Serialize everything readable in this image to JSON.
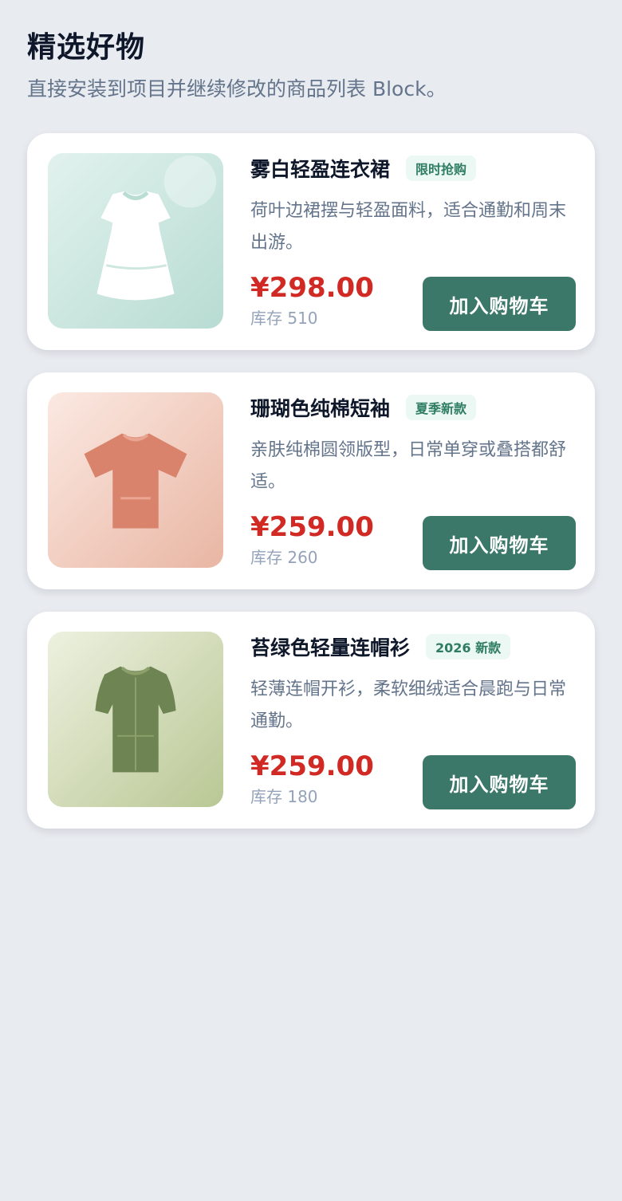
{
  "header": {
    "title": "精选好物",
    "subtitle": "直接安装到项目并继续修改的商品列表 Block。"
  },
  "products": [
    {
      "name": "雾白轻盈连衣裙",
      "badge": "限时抢购",
      "description": "荷叶边裙摆与轻盈面料，适合通勤和周末出游。",
      "price": "¥298.00",
      "stock": "库存 510",
      "button_label": "加入购物车",
      "image_icon": "dress-icon",
      "colors": {
        "bg_from": "#e2f2ee",
        "bg_to": "#b7dcd2",
        "garment": "#ffffff"
      }
    },
    {
      "name": "珊瑚色纯棉短袖",
      "badge": "夏季新款",
      "description": "亲肤纯棉圆领版型，日常单穿或叠搭都舒适。",
      "price": "¥259.00",
      "stock": "库存 260",
      "button_label": "加入购物车",
      "image_icon": "tshirt-icon",
      "colors": {
        "bg_from": "#fbe9e2",
        "bg_to": "#e9b6a3",
        "garment": "#d9836c"
      }
    },
    {
      "name": "苔绿色轻量连帽衫",
      "badge": "2026 新款",
      "description": "轻薄连帽开衫，柔软细绒适合晨跑与日常通勤。",
      "price": "¥259.00",
      "stock": "库存 180",
      "button_label": "加入购物车",
      "image_icon": "hoodie-icon",
      "colors": {
        "bg_from": "#edf1e0",
        "bg_to": "#b9c794",
        "garment": "#6e8452"
      }
    }
  ]
}
